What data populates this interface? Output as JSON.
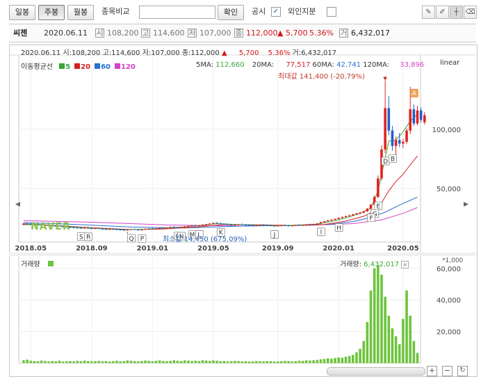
{
  "toolbar": {
    "tabs": [
      {
        "label": "일봉"
      },
      {
        "label": "주봉"
      },
      {
        "label": "월봉"
      }
    ],
    "active_tab": "주봉",
    "compare_label": "종목비교",
    "compare_placeholder": "",
    "confirm_label": "확인",
    "notice_label": "공시",
    "notice_checked": "✓",
    "foreign_label": "외인지분",
    "foreign_checked": ""
  },
  "info": {
    "name": "씨젠",
    "date": "2020.06.11",
    "open": "108,200",
    "high": "114,600",
    "low": "107,000",
    "close": "112,000",
    "change": "▲ 5,700",
    "change_pct": "5.36%",
    "volume": "6,432,017"
  },
  "chart_data": [
    {
      "type": "candlestick",
      "header": {
        "date": "2020.06.11",
        "open_label": "시:",
        "open": "108,200",
        "high_label": "고:",
        "high": "114,600",
        "low_label": "저:",
        "low": "107,000",
        "close_label": "종:",
        "close": "112,000",
        "arrow": "▲",
        "change": "5,700",
        "change_pct": "5.36%",
        "volume_label": "거:",
        "volume": "6,432,017"
      },
      "scale_label": "linear",
      "legend": {
        "title": "이동평균선",
        "items": [
          {
            "name": "5",
            "color": "#3aa43a"
          },
          {
            "name": "20",
            "color": "#d42020"
          },
          {
            "name": "60",
            "color": "#2a6fd1"
          },
          {
            "name": "120",
            "color": "#d341c8"
          }
        ]
      },
      "ma_values": [
        {
          "label": "5MA:",
          "value": "112,660",
          "color": "#3aa43a"
        },
        {
          "label": "20MA:",
          "value": "77,517",
          "color": "#d42020"
        },
        {
          "label": "60MA:",
          "value": "42,741",
          "color": "#2a6fd1"
        },
        {
          "label": "120MA:",
          "value": "33,896",
          "color": "#d341c8"
        }
      ],
      "max_annotation": "최대값 141,400 (-20.79%)",
      "min_annotation": "최소값 14,450 (675.09%)",
      "y_ticks": [
        {
          "value": 50000,
          "label": "50,000"
        },
        {
          "value": 100000,
          "label": "100,000"
        }
      ],
      "x_ticks": [
        {
          "i": 2,
          "label": "2018.05"
        },
        {
          "i": 19,
          "label": "2018.09"
        },
        {
          "i": 36,
          "label": "2019.01"
        },
        {
          "i": 53,
          "label": "2019.05"
        },
        {
          "i": 71,
          "label": "2019.09"
        },
        {
          "i": 88,
          "label": "2020.01"
        },
        {
          "i": 106,
          "label": "2020.05"
        }
      ],
      "watermark": "NAVER",
      "signals": [
        {
          "i": 16,
          "letter": "S"
        },
        {
          "i": 18,
          "letter": "R"
        },
        {
          "i": 30,
          "letter": "Q"
        },
        {
          "i": 33,
          "letter": "P"
        },
        {
          "i": 43,
          "letter": "O"
        },
        {
          "i": 44,
          "letter": "N"
        },
        {
          "i": 47,
          "letter": "M"
        },
        {
          "i": 49,
          "letter": "L"
        },
        {
          "i": 55,
          "letter": "K"
        },
        {
          "i": 70,
          "letter": "J"
        },
        {
          "i": 83,
          "letter": "I"
        },
        {
          "i": 88,
          "letter": "H"
        },
        {
          "i": 98,
          "letter": "G"
        },
        {
          "i": 97,
          "letter": "F"
        },
        {
          "i": 99,
          "letter": "E"
        },
        {
          "i": 101,
          "letter": "C"
        },
        {
          "i": 101,
          "letter": "D"
        },
        {
          "i": 103,
          "letter": "B"
        },
        {
          "i": 109,
          "letter": "A"
        }
      ],
      "candles": [
        [
          19300,
          20800,
          18900,
          20400
        ],
        [
          20400,
          21100,
          19800,
          20300
        ],
        [
          20300,
          20900,
          19500,
          19800
        ],
        [
          19800,
          20500,
          19300,
          20000
        ],
        [
          20000,
          20600,
          19400,
          19600
        ],
        [
          19600,
          20100,
          18800,
          19000
        ],
        [
          19000,
          19700,
          18500,
          19300
        ],
        [
          19300,
          19800,
          18600,
          18800
        ],
        [
          18800,
          19400,
          18200,
          18500
        ],
        [
          18500,
          19100,
          17900,
          18300
        ],
        [
          18300,
          18800,
          17600,
          17900
        ],
        [
          17900,
          18500,
          17300,
          17600
        ],
        [
          17600,
          18200,
          17000,
          17300
        ],
        [
          17300,
          17900,
          16800,
          17100
        ],
        [
          17100,
          17600,
          16500,
          16900
        ],
        [
          16900,
          17400,
          16300,
          16600
        ],
        [
          16600,
          17200,
          16100,
          16400
        ],
        [
          16400,
          17000,
          15900,
          16700
        ],
        [
          16700,
          17100,
          16000,
          16300
        ],
        [
          16300,
          16800,
          15800,
          16100
        ],
        [
          16100,
          16700,
          15600,
          16400
        ],
        [
          16400,
          16900,
          15700,
          15900
        ],
        [
          15900,
          16500,
          15300,
          15600
        ],
        [
          15600,
          16200,
          15100,
          15400
        ],
        [
          15400,
          16000,
          14900,
          15700
        ],
        [
          15700,
          16300,
          15200,
          15500
        ],
        [
          15500,
          16000,
          14900,
          15200
        ],
        [
          15200,
          15800,
          14700,
          15000
        ],
        [
          15000,
          15600,
          14500,
          14900
        ],
        [
          14900,
          15400,
          14450,
          15100
        ],
        [
          15100,
          15900,
          14700,
          15600
        ],
        [
          15600,
          16000,
          14900,
          15200
        ],
        [
          15200,
          15700,
          14600,
          14900
        ],
        [
          14900,
          15500,
          14500,
          15300
        ],
        [
          15300,
          16200,
          15000,
          15900
        ],
        [
          15900,
          16500,
          15400,
          16100
        ],
        [
          16100,
          16700,
          15600,
          15800
        ],
        [
          15800,
          16400,
          15300,
          16200
        ],
        [
          16200,
          17000,
          15800,
          16800
        ],
        [
          16800,
          17400,
          16200,
          16500
        ],
        [
          16500,
          17100,
          16000,
          16900
        ],
        [
          16900,
          17800,
          16500,
          17500
        ],
        [
          17500,
          18200,
          16900,
          17200
        ],
        [
          17200,
          17700,
          16600,
          17000
        ],
        [
          17000,
          17800,
          16500,
          17600
        ],
        [
          17600,
          18300,
          17100,
          17900
        ],
        [
          17900,
          18600,
          17300,
          18300
        ],
        [
          18300,
          19100,
          17800,
          18700
        ],
        [
          18700,
          19300,
          18000,
          18400
        ],
        [
          18400,
          19000,
          17900,
          18800
        ],
        [
          18800,
          19700,
          18300,
          19400
        ],
        [
          19400,
          20100,
          18800,
          19800
        ],
        [
          19800,
          20600,
          19300,
          20300
        ],
        [
          20300,
          21200,
          19800,
          20900
        ],
        [
          20900,
          21600,
          20200,
          20500
        ],
        [
          20500,
          21100,
          19800,
          20100
        ],
        [
          20100,
          20600,
          19400,
          19700
        ],
        [
          19700,
          20300,
          19000,
          19300
        ],
        [
          19300,
          19900,
          18800,
          19100
        ],
        [
          19100,
          19800,
          18600,
          19400
        ],
        [
          19400,
          20100,
          18900,
          19800
        ],
        [
          19800,
          20400,
          19200,
          19500
        ],
        [
          19500,
          20000,
          18900,
          19200
        ],
        [
          19200,
          19800,
          18700,
          19000
        ],
        [
          19000,
          19500,
          18400,
          18700
        ],
        [
          18700,
          19300,
          18200,
          18900
        ],
        [
          18900,
          19600,
          18400,
          19300
        ],
        [
          19300,
          19900,
          18700,
          19000
        ],
        [
          19000,
          19600,
          18500,
          18800
        ],
        [
          18800,
          19400,
          18200,
          18500
        ],
        [
          18500,
          19100,
          17900,
          18200
        ],
        [
          18200,
          18900,
          17800,
          18600
        ],
        [
          18600,
          19300,
          18100,
          18900
        ],
        [
          18900,
          19500,
          18300,
          18600
        ],
        [
          18600,
          19200,
          18000,
          18300
        ],
        [
          18300,
          18900,
          17800,
          18700
        ],
        [
          18700,
          19400,
          18200,
          19100
        ],
        [
          19100,
          19800,
          18500,
          18800
        ],
        [
          18800,
          19400,
          18300,
          19200
        ],
        [
          19200,
          20000,
          18700,
          19700
        ],
        [
          19700,
          20400,
          19200,
          19400
        ],
        [
          19400,
          20200,
          18900,
          19900
        ],
        [
          19900,
          20700,
          19400,
          20500
        ],
        [
          20500,
          21800,
          20100,
          21500
        ],
        [
          21500,
          22600,
          21000,
          22300
        ],
        [
          22300,
          23500,
          21800,
          23100
        ],
        [
          23100,
          24200,
          22600,
          23600
        ],
        [
          23600,
          24600,
          23000,
          24300
        ],
        [
          24300,
          25600,
          23800,
          25200
        ],
        [
          25200,
          26300,
          24600,
          25900
        ],
        [
          25900,
          27000,
          25200,
          26600
        ],
        [
          26600,
          27800,
          26000,
          27300
        ],
        [
          27300,
          28600,
          26700,
          28200
        ],
        [
          28200,
          29500,
          27600,
          29000
        ],
        [
          29000,
          30300,
          28300,
          29600
        ],
        [
          29600,
          31200,
          29000,
          30800
        ],
        [
          30800,
          33500,
          30200,
          32900
        ],
        [
          32900,
          37000,
          32000,
          36200
        ],
        [
          36200,
          44000,
          35500,
          42800
        ],
        [
          42800,
          61000,
          42000,
          58500
        ],
        [
          58500,
          86500,
          57000,
          83000
        ],
        [
          83000,
          141400,
          80000,
          118000
        ],
        [
          118000,
          128000,
          95000,
          99000
        ],
        [
          99000,
          103000,
          82000,
          86000
        ],
        [
          86000,
          94000,
          78000,
          91000
        ],
        [
          91000,
          97000,
          85000,
          88000
        ],
        [
          88000,
          92000,
          84000,
          89500
        ],
        [
          89500,
          101000,
          87500,
          99000
        ],
        [
          99000,
          136000,
          96000,
          117000
        ],
        [
          117000,
          121000,
          103000,
          105000
        ],
        [
          105000,
          120000,
          103500,
          116000
        ],
        [
          116000,
          118500,
          106000,
          108000
        ],
        [
          106000,
          114600,
          104000,
          112000
        ]
      ],
      "ma5": [
        [
          0,
          19500
        ],
        [
          5,
          19100
        ],
        [
          10,
          18000
        ],
        [
          20,
          16300
        ],
        [
          28,
          15100
        ],
        [
          34,
          15500
        ],
        [
          45,
          17600
        ],
        [
          54,
          20300
        ],
        [
          62,
          19300
        ],
        [
          72,
          18500
        ],
        [
          82,
          19800
        ],
        [
          88,
          23500
        ],
        [
          94,
          28800
        ],
        [
          97,
          33500
        ],
        [
          99,
          48000
        ],
        [
          101,
          76000
        ],
        [
          102,
          90000
        ],
        [
          104,
          91000
        ],
        [
          106,
          98000
        ],
        [
          108,
          107000
        ],
        [
          110,
          112660
        ]
      ],
      "ma20": [
        [
          0,
          20100
        ],
        [
          10,
          18500
        ],
        [
          20,
          16700
        ],
        [
          30,
          15300
        ],
        [
          38,
          15600
        ],
        [
          48,
          17400
        ],
        [
          56,
          19600
        ],
        [
          66,
          19300
        ],
        [
          76,
          18700
        ],
        [
          84,
          19600
        ],
        [
          90,
          22400
        ],
        [
          95,
          26500
        ],
        [
          98,
          31000
        ],
        [
          100,
          38000
        ],
        [
          102,
          48000
        ],
        [
          104,
          56000
        ],
        [
          106,
          62000
        ],
        [
          108,
          70000
        ],
        [
          110,
          77517
        ]
      ],
      "ma60": [
        [
          0,
          21200
        ],
        [
          15,
          19600
        ],
        [
          30,
          17400
        ],
        [
          45,
          16600
        ],
        [
          60,
          18200
        ],
        [
          75,
          18900
        ],
        [
          85,
          19500
        ],
        [
          92,
          22000
        ],
        [
          97,
          25600
        ],
        [
          101,
          30000
        ],
        [
          105,
          36000
        ],
        [
          108,
          40000
        ],
        [
          110,
          42741
        ]
      ],
      "ma120": [
        [
          0,
          22800
        ],
        [
          20,
          21400
        ],
        [
          40,
          19200
        ],
        [
          60,
          18300
        ],
        [
          80,
          18900
        ],
        [
          92,
          20300
        ],
        [
          100,
          23500
        ],
        [
          106,
          29000
        ],
        [
          110,
          33896
        ]
      ],
      "volume_header": {
        "label": "거래량",
        "value_label": "거래량:",
        "value": "6,432,017"
      },
      "volume_unit": "*1,000",
      "volume_ticks": [
        {
          "value": 20000,
          "label": "20,000"
        },
        {
          "value": 40000,
          "label": "40,000"
        },
        {
          "value": 60000,
          "label": "60,000"
        }
      ],
      "volume": [
        1800,
        2200,
        1500,
        1300,
        1200,
        1600,
        1400,
        1100,
        1300,
        1200,
        1500,
        1000,
        1200,
        1300,
        1100,
        1400,
        1200,
        1600,
        1300,
        1100,
        1200,
        1400,
        1100,
        1300,
        1000,
        1200,
        1500,
        1100,
        1300,
        1700,
        1500,
        1200,
        1100,
        1300,
        1600,
        1400,
        1200,
        1500,
        1700,
        1300,
        1200,
        1400,
        1800,
        1500,
        1300,
        1700,
        1600,
        1400,
        1500,
        1300,
        1800,
        1600,
        1400,
        1700,
        1500,
        1200,
        1300,
        1100,
        1200,
        1400,
        1300,
        1100,
        1200,
        1000,
        1100,
        1300,
        1200,
        1100,
        1300,
        1200,
        1000,
        1100,
        1200,
        1400,
        1300,
        1100,
        1200,
        1500,
        1400,
        1700,
        1600,
        1800,
        2000,
        2400,
        2600,
        3000,
        2800,
        3200,
        3600,
        3400,
        4000,
        4500,
        5200,
        6800,
        9000,
        14000,
        26000,
        46000,
        60000,
        62000,
        56000,
        42000,
        30000,
        22000,
        17000,
        12000,
        28000,
        46000,
        30000,
        14000,
        6432
      ]
    }
  ],
  "nav": {
    "left_arrow": "◀",
    "right_arrow": "▶",
    "zoom_in": "+",
    "zoom_out": "−",
    "reset": "↻"
  }
}
